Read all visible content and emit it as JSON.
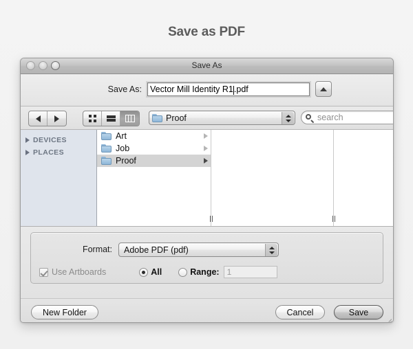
{
  "page": {
    "heading": "Save as PDF",
    "background_color": "#f2f2f2"
  },
  "window": {
    "title": "Save As",
    "traffic_lights": [
      "close-button",
      "minimize-button",
      "zoom-button"
    ]
  },
  "name_row": {
    "label": "Save As:",
    "filename_before_caret": "Vector Mill Identity R1",
    "filename_after_caret": ".pdf",
    "filename_full": "Vector Mill Identity R1.pdf",
    "disclosure_icon": "triangle-up-icon"
  },
  "toolbar": {
    "back_icon": "arrow-left-icon",
    "forward_icon": "arrow-right-icon",
    "view_modes": [
      {
        "name": "icon-view",
        "icon": "grid-icon",
        "selected": false
      },
      {
        "name": "list-view",
        "icon": "list-icon",
        "selected": false
      },
      {
        "name": "column-view",
        "icon": "columns-icon",
        "selected": true
      }
    ],
    "location": {
      "icon": "folder-icon",
      "label": "Proof"
    },
    "search": {
      "icon": "search-icon",
      "placeholder": "search",
      "value": ""
    }
  },
  "sidebar": {
    "groups": [
      {
        "label": "DEVICES",
        "expanded": false,
        "icon": "disclosure-triangle-icon"
      },
      {
        "label": "PLACES",
        "expanded": false,
        "icon": "disclosure-triangle-icon"
      }
    ]
  },
  "file_browser": {
    "column_one": [
      {
        "name": "Art",
        "icon": "folder-icon",
        "selected": false,
        "chevron": "chevron-right-icon"
      },
      {
        "name": "Job",
        "icon": "folder-icon",
        "selected": false,
        "chevron": "chevron-right-icon"
      },
      {
        "name": "Proof",
        "icon": "folder-icon",
        "selected": true,
        "chevron": "chevron-right-icon"
      }
    ],
    "column_two": [],
    "column_three": []
  },
  "options": {
    "format_label": "Format:",
    "format_value": "Adobe PDF (pdf)",
    "use_artboards": {
      "label": "Use Artboards",
      "checked": true,
      "enabled": false
    },
    "all_radio": {
      "label": "All",
      "selected": true
    },
    "range_radio": {
      "label": "Range:",
      "selected": false
    },
    "range_value": "1"
  },
  "footer": {
    "new_folder_label": "New Folder",
    "cancel_label": "Cancel",
    "save_label": "Save"
  }
}
